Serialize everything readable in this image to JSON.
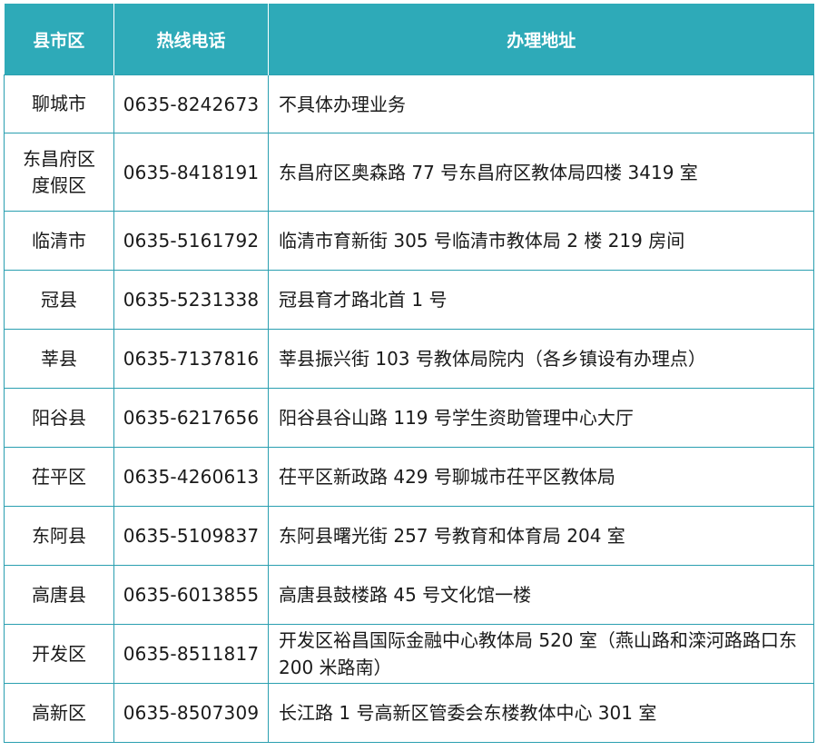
{
  "header": {
    "county": "县市区",
    "phone": "热线电话",
    "address": "办理地址"
  },
  "rows": [
    {
      "county": [
        "聊城市"
      ],
      "phone": "0635-8242673",
      "address": "不具体办理业务"
    },
    {
      "county": [
        "东昌府区",
        "度假区"
      ],
      "phone": "0635-8418191",
      "address": "东昌府区奥森路 77 号东昌府区教体局四楼 3419 室"
    },
    {
      "county": [
        "临清市"
      ],
      "phone": "0635-5161792",
      "address": "临清市育新街 305 号临清市教体局 2 楼 219 房间"
    },
    {
      "county": [
        "冠县"
      ],
      "phone": "0635-5231338",
      "address": "冠县育才路北首 1 号"
    },
    {
      "county": [
        "莘县"
      ],
      "phone": "0635-7137816",
      "address": "莘县振兴街 103 号教体局院内（各乡镇设有办理点）"
    },
    {
      "county": [
        "阳谷县"
      ],
      "phone": "0635-6217656",
      "address": "阳谷县谷山路 119 号学生资助管理中心大厅"
    },
    {
      "county": [
        "茌平区"
      ],
      "phone": "0635-4260613",
      "address": "茌平区新政路 429 号聊城市茌平区教体局"
    },
    {
      "county": [
        "东阿县"
      ],
      "phone": "0635-5109837",
      "address": "东阿县曙光街 257 号教育和体育局 204 室"
    },
    {
      "county": [
        "高唐县"
      ],
      "phone": "0635-6013855",
      "address": "高唐县鼓楼路 45 号文化馆一楼"
    },
    {
      "county": [
        "开发区"
      ],
      "phone": "0635-8511817",
      "address": "开发区裕昌国际金融中心教体局 520 室（燕山路和滦河路路口东 200 米路南）"
    },
    {
      "county": [
        "高新区"
      ],
      "phone": "0635-8507309",
      "address": "长江路 1 号高新区管委会东楼教体中心 301 室"
    }
  ]
}
